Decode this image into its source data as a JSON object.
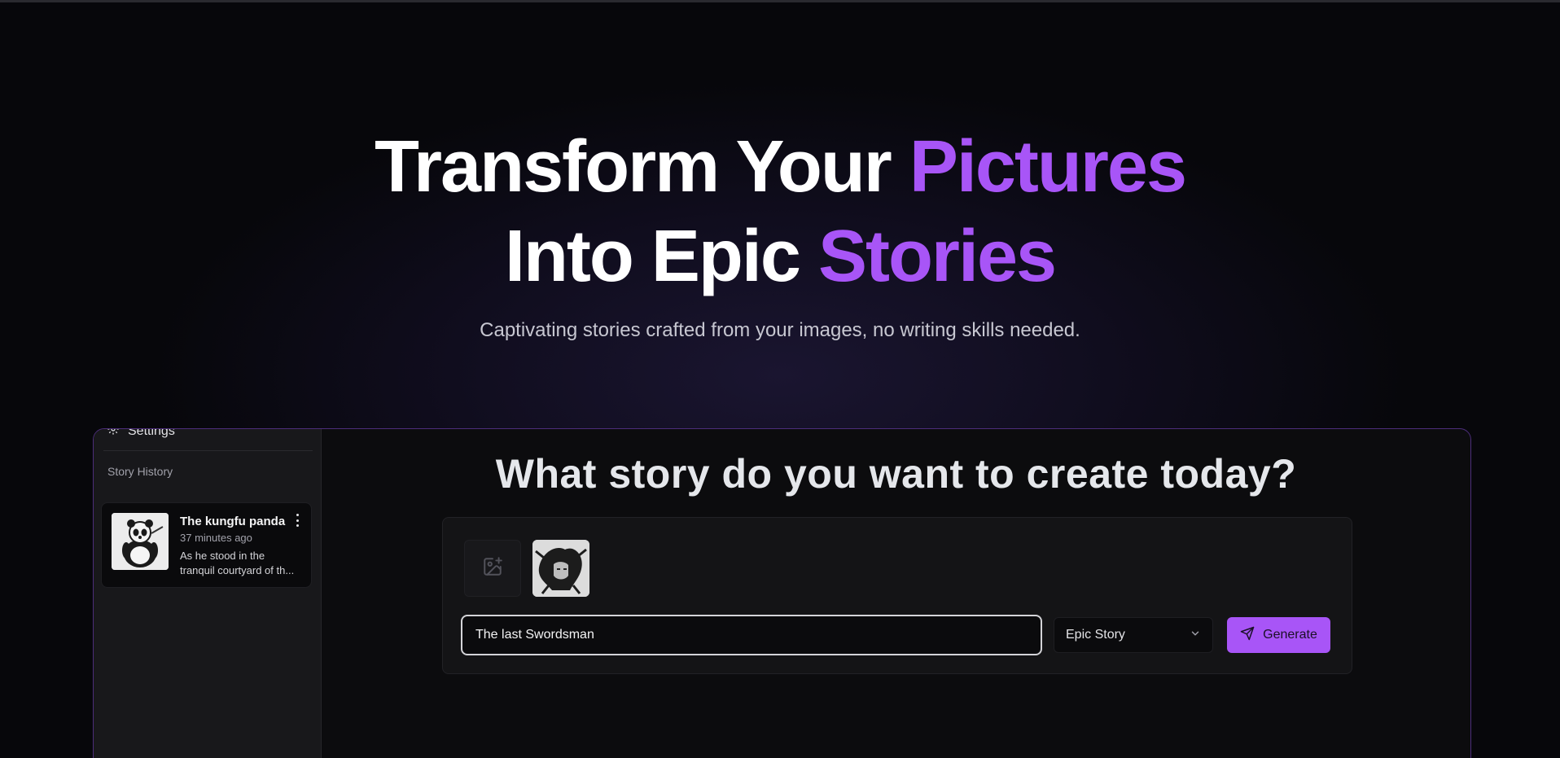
{
  "hero": {
    "title_line1_prefix": "Transform Your ",
    "title_line1_accent": "Pictures",
    "title_line2_prefix": "Into Epic ",
    "title_line2_accent": "Stories",
    "subtitle": "Captivating stories crafted from your images, no writing skills needed.",
    "accent_color": "#a855f7"
  },
  "sidebar": {
    "settings_label": "Settings",
    "history_title": "Story History",
    "history": [
      {
        "title": "The kungfu panda",
        "time": "37 minutes ago",
        "snippet_line1": "As he stood in the",
        "snippet_line2": "tranquil courtyard of th...",
        "thumbnail": "panda-image"
      }
    ]
  },
  "main": {
    "heading": "What story do you want to create today?",
    "add_image_icon": "image-plus-icon",
    "uploaded_image": "swordsman-image",
    "title_input_value": "The last Swordsman",
    "style_select_value": "Epic Story",
    "generate_label": "Generate",
    "generate_icon": "send-icon"
  }
}
